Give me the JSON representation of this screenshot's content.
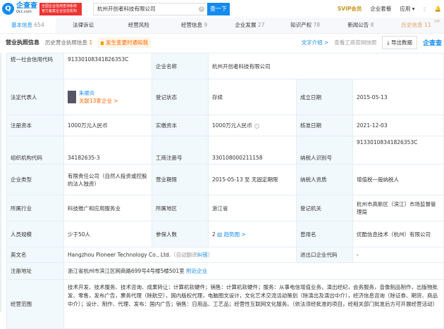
{
  "header": {
    "logo_name": "企查查",
    "logo_domain": "Qcc.com",
    "badge_lines": [
      "全国企业信用查询系统",
      "官方备案企业征信机构"
    ],
    "search_value": "杭州开创者科技有限公司",
    "search_button": "查一下",
    "svip": "SVIP会员",
    "package": "企业套餐",
    "apps": "应用 ▾"
  },
  "tabs": [
    {
      "label": "基本信息",
      "count": "654"
    },
    {
      "label": "法律诉讼",
      "count": ""
    },
    {
      "label": "经营风险",
      "count": ""
    },
    {
      "label": "经营信息",
      "count": "9"
    },
    {
      "label": "企业发展",
      "count": "27"
    },
    {
      "label": "知识产权",
      "count": "78"
    },
    {
      "label": "新闻公告",
      "count": "8"
    },
    {
      "label": "历史信息",
      "count": "11",
      "badge": "VIP"
    }
  ],
  "section": {
    "title": "营业执照信息",
    "history_label": "历史营业执照信息",
    "history_count": "1",
    "notify": "发生变更时通知我",
    "intro": "文字介绍 >",
    "snapshot": "查看工商官网快照",
    "export": "导出数据",
    "watermark": "企查查"
  },
  "fields": {
    "credit_code": {
      "label": "统一社会信用代码",
      "value": "91330108341826353C"
    },
    "name": {
      "label": "企业名称",
      "value": "杭州开创者科技有限公司"
    },
    "legal_rep": {
      "label": "法定代表人",
      "value": "朱顺炎",
      "related": "关联13家企业 >"
    },
    "status": {
      "label": "登记状态",
      "value": "存续"
    },
    "founded": {
      "label": "成立日期",
      "value": "2015-05-13"
    },
    "reg_capital": {
      "label": "注册资本",
      "value": "1000万元人民币"
    },
    "paid_capital": {
      "label": "实缴资本",
      "value": "1000万元人民币"
    },
    "approved": {
      "label": "核准日期",
      "value": "2021-12-03"
    },
    "org_code": {
      "label": "组织机构代码",
      "value": "34182635-3"
    },
    "reg_no": {
      "label": "工商注册号",
      "value": "330108000211158"
    },
    "taxpayer_id": {
      "label": "纳税人识别号",
      "value": "91330108341826353C"
    },
    "type": {
      "label": "企业类型",
      "value": "有限责任公司（自然人投资或控股的法人独资）"
    },
    "term": {
      "label": "营业期限",
      "value": "2015-05-13 至 无固定期限"
    },
    "tax_quality": {
      "label": "纳税人资质",
      "value": "增值税一般纳税人"
    },
    "industry": {
      "label": "所属行业",
      "value": "科技推广和应用服务业"
    },
    "region": {
      "label": "所属地区",
      "value": "浙江省"
    },
    "authority": {
      "label": "登记机关",
      "value": "杭州市高新区（滨江）市场监督管理局"
    },
    "staff": {
      "label": "人员规模",
      "value": "少于50人"
    },
    "insured": {
      "label": "参保人数",
      "value": "2",
      "trend": "趋势图 >"
    },
    "former": {
      "label": "曾用名",
      "value": "优酷信息技术（杭州）有限公司"
    },
    "english": {
      "label": "英文名",
      "value": "Hangzhou Pioneer Technology Co., Ltd.",
      "auto": "（自动翻译",
      "fix": "纠错",
      "close": "）"
    },
    "import_code": {
      "label": "进出口企业代码",
      "value": "-"
    },
    "address": {
      "label": "注册地址",
      "value": "浙江省杭州市滨江区网商路699号4号楼5楼501室",
      "nearby": "附近企业"
    },
    "scope": {
      "label": "经营范围",
      "value": "技术开发、技术服务、技术咨询、成果转让：计算机软硬件；销售：计算机软硬件；服务：从事电信增值业务，演出经纪，会务服务，音像制品制作，出版物批发、零售，发布广告，票务代理（除航空），国内版权代理，电脑图文设计，文化艺术交流活动策划（除演出及演出中介），经济信息咨询（除证券、期货、商品中介）；设计、制作、代理、发布：国内广告；销售：日用品、工艺品；经营性互联网文化服务。（依法须经批准的项目，经相关部门批准后方可开展经营活动）"
    }
  }
}
